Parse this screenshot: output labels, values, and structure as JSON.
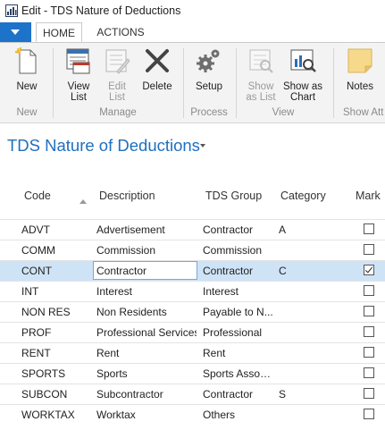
{
  "window": {
    "title": "Edit - TDS Nature of Deductions",
    "app_icon": "chart-bars-icon"
  },
  "ribbon_tabs": [
    {
      "label": "HOME"
    },
    {
      "label": "ACTIONS"
    }
  ],
  "ribbon": {
    "buttons": {
      "new": {
        "label": "New",
        "icon": "new-document-icon"
      },
      "view_list": {
        "label1": "View",
        "label2": "List",
        "icon": "view-list-icon"
      },
      "edit_list": {
        "label1": "Edit",
        "label2": "List",
        "icon": "edit-list-icon"
      },
      "delete": {
        "label": "Delete",
        "icon": "delete-x-icon"
      },
      "setup": {
        "label": "Setup",
        "icon": "gears-icon"
      },
      "show_as_list": {
        "label1": "Show",
        "label2": "as List",
        "icon": "show-as-list-icon"
      },
      "show_as_chart": {
        "label1": "Show as",
        "label2": "Chart",
        "icon": "show-as-chart-icon"
      },
      "notes": {
        "label": "Notes",
        "icon": "note-icon"
      }
    },
    "groups": {
      "new": "New",
      "manage": "Manage",
      "process": "Process",
      "view": "View",
      "show_attached": "Show Att"
    }
  },
  "page": {
    "title": "TDS Nature of Deductions"
  },
  "grid": {
    "columns": {
      "code": "Code",
      "description": "Description",
      "tds_group": "TDS Group",
      "category": "Category",
      "mark": "Mark"
    },
    "rows": [
      {
        "code": "ADVT",
        "description": "Advertisement",
        "tds_group": "Contractor",
        "category": "A",
        "mark": false
      },
      {
        "code": "COMM",
        "description": "Commission",
        "tds_group": "Commission",
        "category": "",
        "mark": false
      },
      {
        "code": "CONT",
        "description": "Contractor",
        "tds_group": "Contractor",
        "category": "C",
        "mark": true
      },
      {
        "code": "INT",
        "description": "Interest",
        "tds_group": "Interest",
        "category": "",
        "mark": false
      },
      {
        "code": "NON RES",
        "description": "Non Residents",
        "tds_group": "Payable to N...",
        "category": "",
        "mark": false
      },
      {
        "code": "PROF",
        "description": "Professional Services",
        "tds_group": "Professional",
        "category": "",
        "mark": false
      },
      {
        "code": "RENT",
        "description": "Rent",
        "tds_group": "Rent",
        "category": "",
        "mark": false
      },
      {
        "code": "SPORTS",
        "description": "Sports",
        "tds_group": "Sports Assoc...",
        "category": "",
        "mark": false
      },
      {
        "code": "SUBCON",
        "description": "Subcontractor",
        "tds_group": "Contractor",
        "category": "S",
        "mark": false
      },
      {
        "code": "WORKTAX",
        "description": "Worktax",
        "tds_group": "Others",
        "category": "",
        "mark": false
      }
    ],
    "selected_row": 2
  },
  "colors": {
    "accent": "#1c73c9",
    "title_blue": "#1f6fbf",
    "selection": "#cfe3f6"
  }
}
